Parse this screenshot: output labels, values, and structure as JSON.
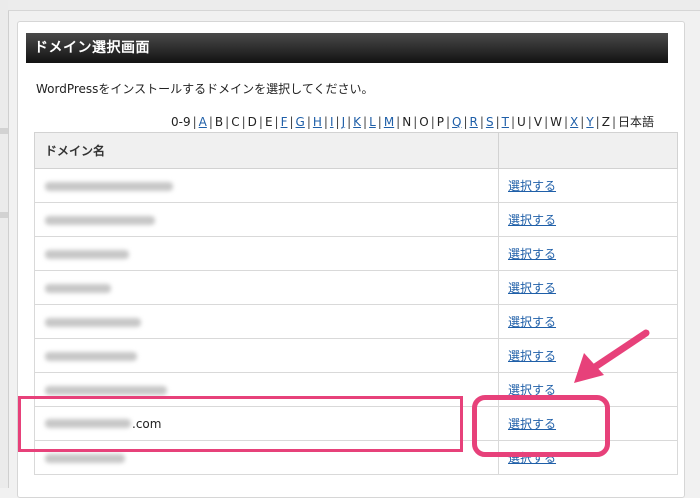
{
  "panel": {
    "title": "ドメイン選択画面",
    "instruction": "WordPressをインストールするドメインを選択してください。"
  },
  "alpha_nav": [
    {
      "label": "0-9",
      "link": false
    },
    {
      "label": "A",
      "link": true
    },
    {
      "label": "B",
      "link": false
    },
    {
      "label": "C",
      "link": false
    },
    {
      "label": "D",
      "link": false
    },
    {
      "label": "E",
      "link": false
    },
    {
      "label": "F",
      "link": true
    },
    {
      "label": "G",
      "link": true
    },
    {
      "label": "H",
      "link": true
    },
    {
      "label": "I",
      "link": true
    },
    {
      "label": "J",
      "link": true
    },
    {
      "label": "K",
      "link": true
    },
    {
      "label": "L",
      "link": true
    },
    {
      "label": "M",
      "link": true
    },
    {
      "label": "N",
      "link": false
    },
    {
      "label": "O",
      "link": false
    },
    {
      "label": "P",
      "link": false
    },
    {
      "label": "Q",
      "link": true
    },
    {
      "label": "R",
      "link": true
    },
    {
      "label": "S",
      "link": true
    },
    {
      "label": "T",
      "link": true
    },
    {
      "label": "U",
      "link": false
    },
    {
      "label": "V",
      "link": false
    },
    {
      "label": "W",
      "link": false
    },
    {
      "label": "X",
      "link": true
    },
    {
      "label": "Y",
      "link": true
    },
    {
      "label": "Z",
      "link": false
    },
    {
      "label": "日本語",
      "link": false
    }
  ],
  "table": {
    "header_domain": "ドメイン名",
    "header_action": "",
    "select_label": "選択する",
    "rows": [
      {
        "domain_visible": ""
      },
      {
        "domain_visible": ""
      },
      {
        "domain_visible": ""
      },
      {
        "domain_visible": ""
      },
      {
        "domain_visible": ""
      },
      {
        "domain_visible": ""
      },
      {
        "domain_visible": ""
      },
      {
        "domain_visible": ".com"
      },
      {
        "domain_visible": ""
      }
    ]
  },
  "colors": {
    "header_bg": "#121212",
    "link": "#1f5fa8",
    "highlight": "#e7417a"
  }
}
